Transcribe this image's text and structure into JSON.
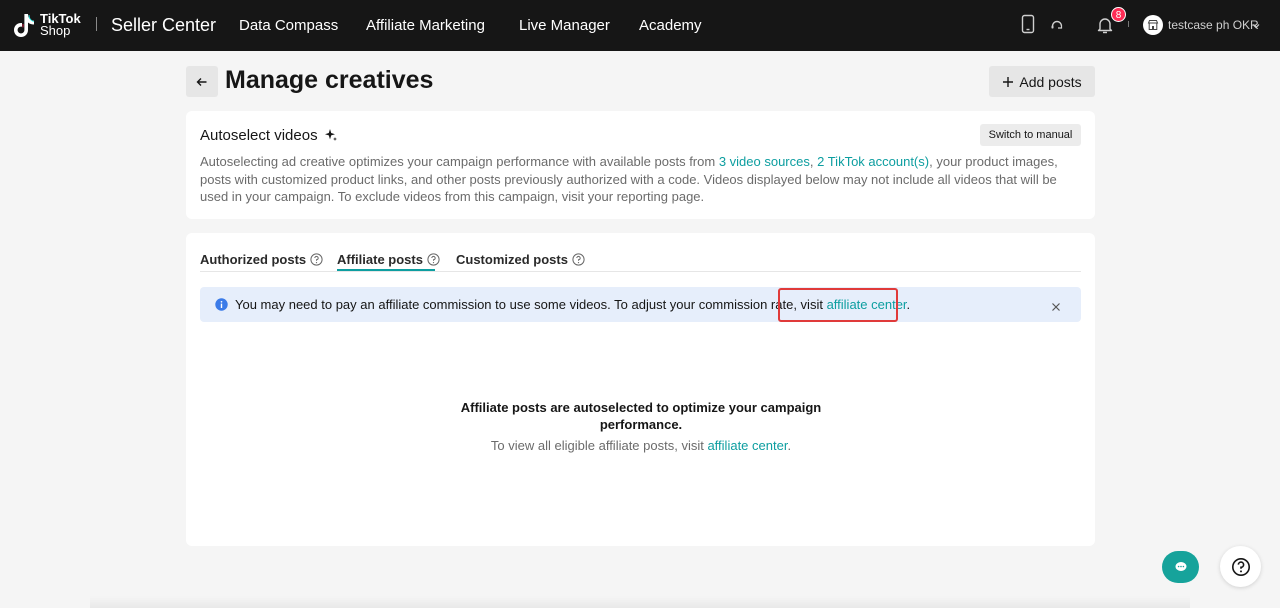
{
  "topnav": {
    "logo_line1": "TikTok",
    "logo_line2": "Shop",
    "brand": "Seller Center",
    "links": [
      "Data Compass",
      "Affiliate Marketing",
      "Live Manager",
      "Academy"
    ],
    "notification_count": "8",
    "username": "testcase ph OKR",
    "icons": [
      "mobile-icon",
      "headset-icon",
      "bell-icon",
      "store-icon",
      "chevron-down-icon"
    ]
  },
  "header": {
    "title": "Manage creatives",
    "add_posts_label": "Add posts"
  },
  "autoselect": {
    "title": "Autoselect videos",
    "switch_label": "Switch to manual",
    "desc_prefix": "Autoselecting ad creative optimizes your campaign performance with available posts from ",
    "video_sources_link": "3 video sources",
    "desc_comma": ", ",
    "accounts_link": "2 TikTok account(s)",
    "desc_suffix": ", your product images, posts with customized product links, and other posts previously authorized with a code. Videos displayed below may not include all videos that will be used in your campaign. To exclude videos from this campaign, visit your reporting page."
  },
  "tabs": [
    {
      "label": "Authorized posts",
      "active": false
    },
    {
      "label": "Affiliate posts",
      "active": true
    },
    {
      "label": "Customized posts",
      "active": false
    }
  ],
  "banner": {
    "text": "You may need to pay an affiliate commission to use some videos. To adjust your commission rate, visit ",
    "link": "affiliate center",
    "end": "."
  },
  "empty": {
    "title": "Affiliate posts are autoselected to optimize your campaign performance.",
    "sub_prefix": "To view all eligible affiliate posts, visit ",
    "sub_link": "affiliate center",
    "sub_end": "."
  },
  "colors": {
    "accent": "#0d9ea0",
    "nav_bg": "#161616",
    "banner_bg": "#e6eefb",
    "highlight": "#e03a3a",
    "chat_button": "#16a39b"
  }
}
